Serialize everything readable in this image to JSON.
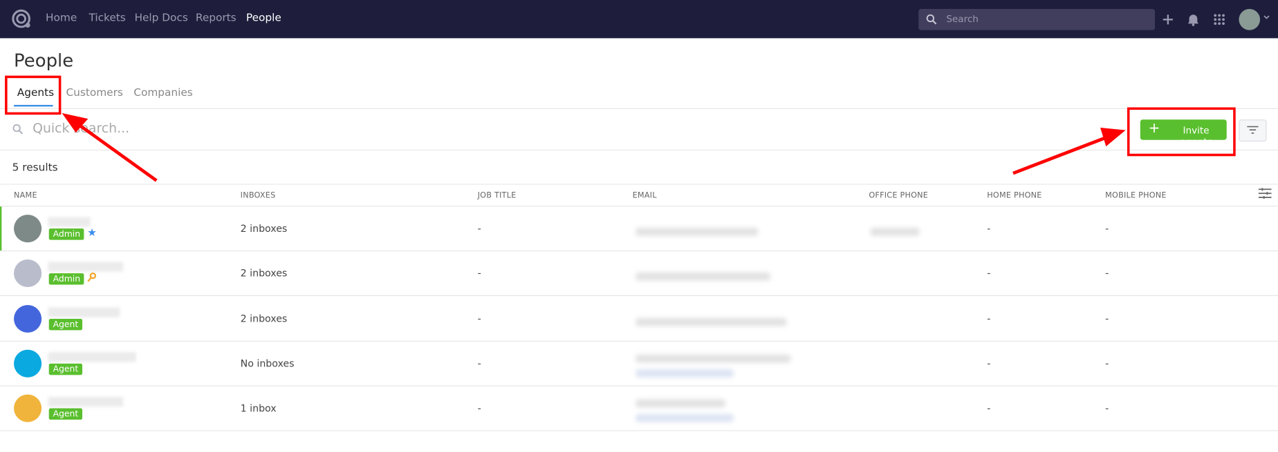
{
  "nav": {
    "items": [
      "Home",
      "Tickets",
      "Help Docs",
      "Reports",
      "People"
    ],
    "active": "People",
    "search_placeholder": "Search"
  },
  "page": {
    "title": "People",
    "tabs": [
      "Agents",
      "Customers",
      "Companies"
    ],
    "active_tab": "Agents",
    "quick_search_placeholder": "Quick search...",
    "invite_label": "Invite agents",
    "results_label": "5 results"
  },
  "table": {
    "columns": [
      "NAME",
      "INBOXES",
      "JOB TITLE",
      "EMAIL",
      "OFFICE PHONE",
      "HOME PHONE",
      "MOBILE PHONE"
    ],
    "rows": [
      {
        "role": "Admin",
        "role_icon": "star-icon",
        "avatar_color": "#7d8a88",
        "inboxes": "2 inboxes",
        "job_title": "-",
        "home_phone": "-",
        "mobile_phone": "-"
      },
      {
        "role": "Admin",
        "role_icon": "key-icon",
        "avatar_color": "#b8bccb",
        "inboxes": "2 inboxes",
        "job_title": "-",
        "home_phone": "-",
        "mobile_phone": "-"
      },
      {
        "role": "Agent",
        "role_icon": "",
        "avatar_color": "#4466dd",
        "inboxes": "2 inboxes",
        "job_title": "-",
        "home_phone": "-",
        "mobile_phone": "-"
      },
      {
        "role": "Agent",
        "role_icon": "",
        "avatar_color": "#0aa9e0",
        "inboxes": "No inboxes",
        "job_title": "-",
        "home_phone": "-",
        "mobile_phone": "-"
      },
      {
        "role": "Agent",
        "role_icon": "",
        "avatar_color": "#f0b43c",
        "inboxes": "1 inbox",
        "job_title": "-",
        "home_phone": "-",
        "mobile_phone": "-"
      }
    ]
  },
  "colors": {
    "nav_bg": "#1e1e3c",
    "accent_green": "#5abf2e",
    "tab_underline": "#3b8fe8",
    "annotation_red": "#ff0000"
  }
}
